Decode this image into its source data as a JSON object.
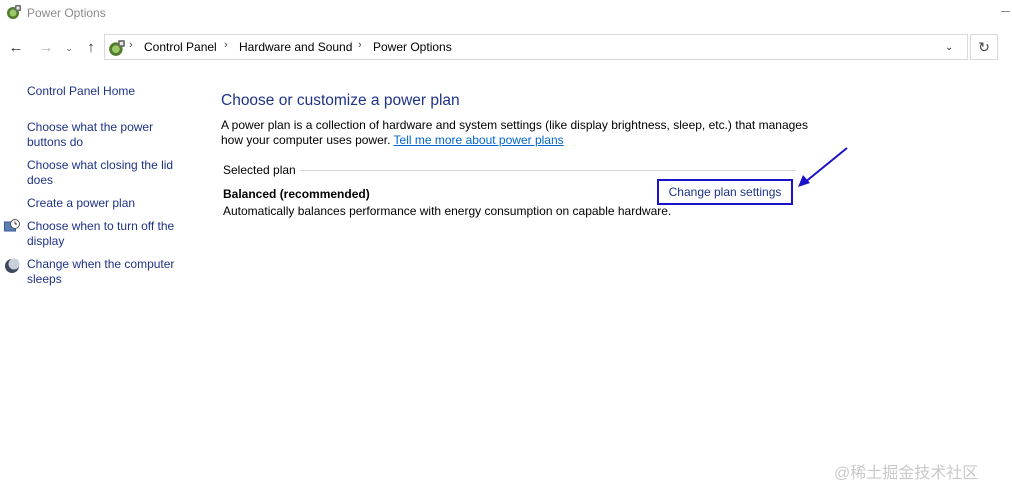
{
  "window": {
    "title": "Power Options",
    "app_icon": "power-options-icon"
  },
  "nav": {
    "back_icon": "back-arrow-icon",
    "forward_icon": "forward-arrow-icon",
    "recent_icon": "chevron-down-icon",
    "up_icon": "up-arrow-icon",
    "breadcrumb": [
      "Control Panel",
      "Hardware and Sound",
      "Power Options"
    ],
    "refresh_icon": "refresh-icon"
  },
  "sidebar": {
    "items": [
      {
        "label": "Control Panel Home",
        "icon": null
      },
      {
        "label": "Choose what the power buttons do",
        "icon": null
      },
      {
        "label": "Choose what closing the lid does",
        "icon": null
      },
      {
        "label": "Create a power plan",
        "icon": null
      },
      {
        "label": "Choose when to turn off the display",
        "icon": "display-clock-icon"
      },
      {
        "label": "Change when the computer sleeps",
        "icon": "moon-icon"
      }
    ]
  },
  "main": {
    "title": "Choose or customize a power plan",
    "description": "A power plan is a collection of hardware and system settings (like display brightness, sleep, etc.) that manages how your computer uses power.",
    "learn_more_link": "Tell me more about power plans",
    "section_label": "Selected plan",
    "plan": {
      "name": "Balanced (recommended)",
      "description": "Automatically balances performance with energy consumption on capable hardware.",
      "change_link": "Change plan settings"
    }
  },
  "annotation": {
    "highlight_color": "#1a12c8"
  },
  "watermark": "@稀土掘金技术社区"
}
